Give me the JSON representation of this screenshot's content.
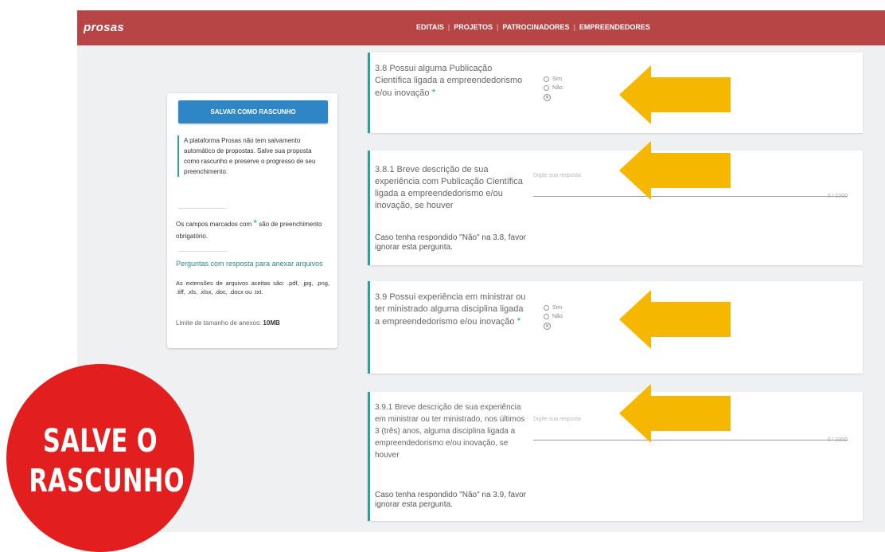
{
  "header": {
    "logo": "prosas",
    "nav": [
      "EDITAIS",
      "PROJETOS",
      "PATROCINADORES",
      "EMPREENDEDORES"
    ]
  },
  "sidebar": {
    "save_button": "SALVAR COMO RASCUNHO",
    "notice": "A plataforma Prosas não tem salvamento automático de propostas. Salve sua proposta como rascunho e preserve o progresso de seu preenchimento.",
    "required_pre": "Os campos marcados com",
    "required_post": "são de preenchimento obrigatório.",
    "attach_link": "Perguntas com resposta para anexar arquivos",
    "attach_text": "As extensões de arquivos aceitas são: .pdf, .jpg, .png, .tiff, .xls, .xlsx, .doc, .docx ou .txt.",
    "limit_label": "Limite de tamanho de anexos:",
    "limit_value": "10MB"
  },
  "questions": {
    "q38": {
      "label": "3.8 Possui alguma Publicação Científica ligada a empreendedorismo e/ou inovação",
      "star": "*",
      "opt_yes": "Sim",
      "opt_no": "Não"
    },
    "q381": {
      "label": "3.8.1 Breve descrição de sua experiência com Publicação Científica ligada a empreendedorismo e/ou inovação, se houver",
      "help": "Caso tenha respondido \"Não\" na 3.8, favor ignorar esta pergunta.",
      "placeholder": "Digite sua resposta",
      "counter": "0 / 1000"
    },
    "q39": {
      "label": "3.9 Possui experiência em ministrar ou ter ministrado alguma disciplina ligada a empreendedorismo e/ou inovação",
      "star": "*",
      "opt_yes": "Sim",
      "opt_no": "Não"
    },
    "q391": {
      "label": "3.9.1 Breve descrição de sua experiência em ministrar ou ter ministrado, nos últimos 3 (três) anos, alguma disciplina ligada a empreendedorismo e/ou inovação, se houver",
      "help": "Caso tenha respondido \"Não\" na 3.9, favor ignorar esta pergunta.",
      "placeholder": "Digite sua resposta",
      "counter": "0 / 1000"
    }
  },
  "overlay": {
    "badge_line1": "SALVE O",
    "badge_line2": "RASCUNHO",
    "arrow_color": "#f5b700",
    "badge_color": "#e31e1e"
  }
}
